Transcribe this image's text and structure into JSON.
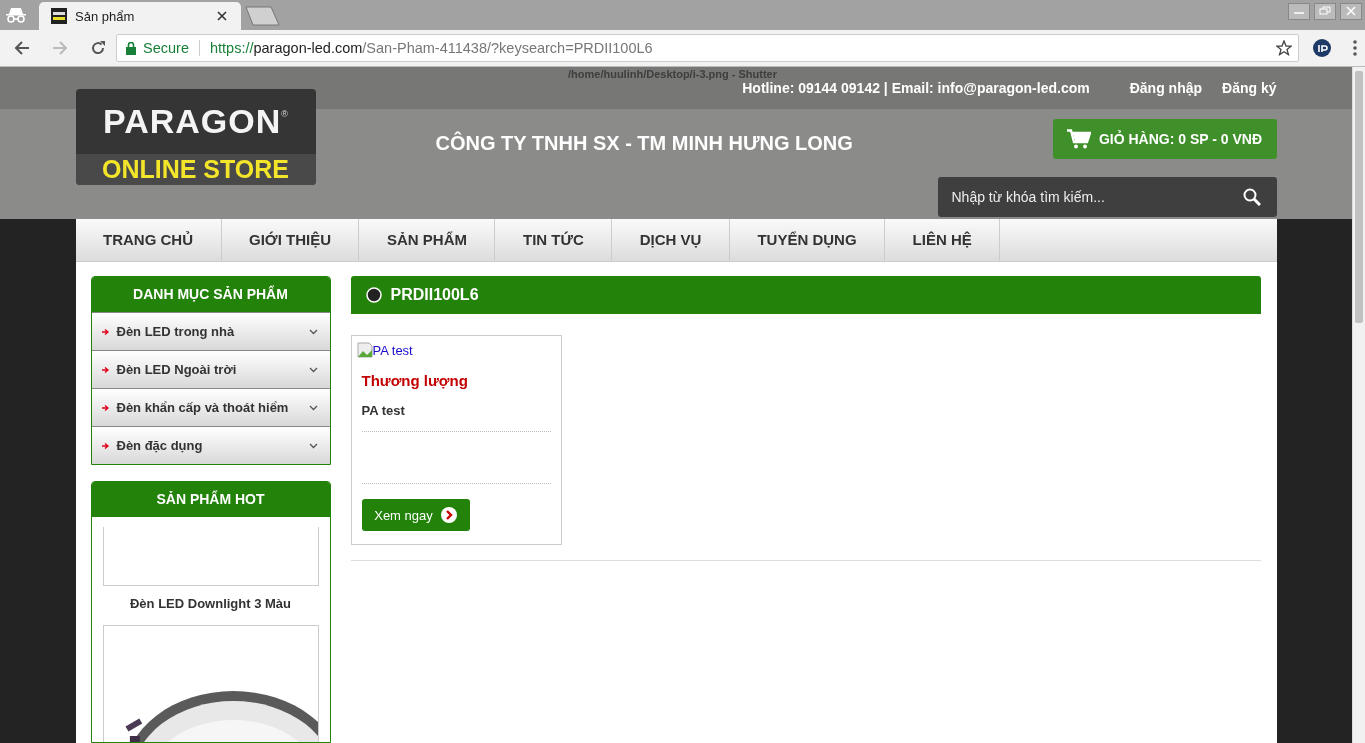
{
  "browser": {
    "tab": {
      "title": "Sản phẩm"
    },
    "address": {
      "secure_label": "Secure",
      "scheme": "https://",
      "host": "paragon-led.com",
      "path": "/San-Pham-411438/?keysearch=PRDII100L6"
    }
  },
  "overlay_title": "/home/huulinh/Desktop/i-3.png - Shutter",
  "header": {
    "logo": {
      "brand": "PARAGON",
      "trademark": "®",
      "tagline": "ONLINE STORE"
    },
    "company": "CÔNG TY TNHH SX - TM MINH HƯNG LONG",
    "contact": "Hotline: 09144 09142 | Email: info@paragon-led.com",
    "links": [
      "Đăng nhập",
      "Đăng ký"
    ],
    "cart": "GIỎ HÀNG: 0 SP - 0 VNĐ",
    "search": {
      "placeholder": "Nhập từ khóa tìm kiếm..."
    }
  },
  "nav": [
    {
      "label": "TRANG CHỦ"
    },
    {
      "label": "GIỚI THIỆU"
    },
    {
      "label": "SẢN PHẨM"
    },
    {
      "label": "TIN TỨC"
    },
    {
      "label": "DỊCH VỤ"
    },
    {
      "label": "TUYỂN DỤNG"
    },
    {
      "label": "LIÊN HỆ"
    }
  ],
  "sidebar": {
    "categories": {
      "title": "DANH MỤC SẢN PHẨM",
      "items": [
        {
          "label": "Đèn LED trong nhà"
        },
        {
          "label": "Đèn LED Ngoài trời"
        },
        {
          "label": "Đèn khẩn cấp và thoát hiểm"
        },
        {
          "label": "Đèn đặc dụng"
        }
      ]
    },
    "hot": {
      "title": "SẢN PHẨM HOT",
      "caption": "Đèn LED Downlight 3 Màu"
    }
  },
  "content": {
    "title": "PRDII100L6",
    "products": [
      {
        "image_alt": "PA test",
        "price": "Thương lượng",
        "name": "PA test",
        "button": "Xem ngay"
      }
    ]
  }
}
